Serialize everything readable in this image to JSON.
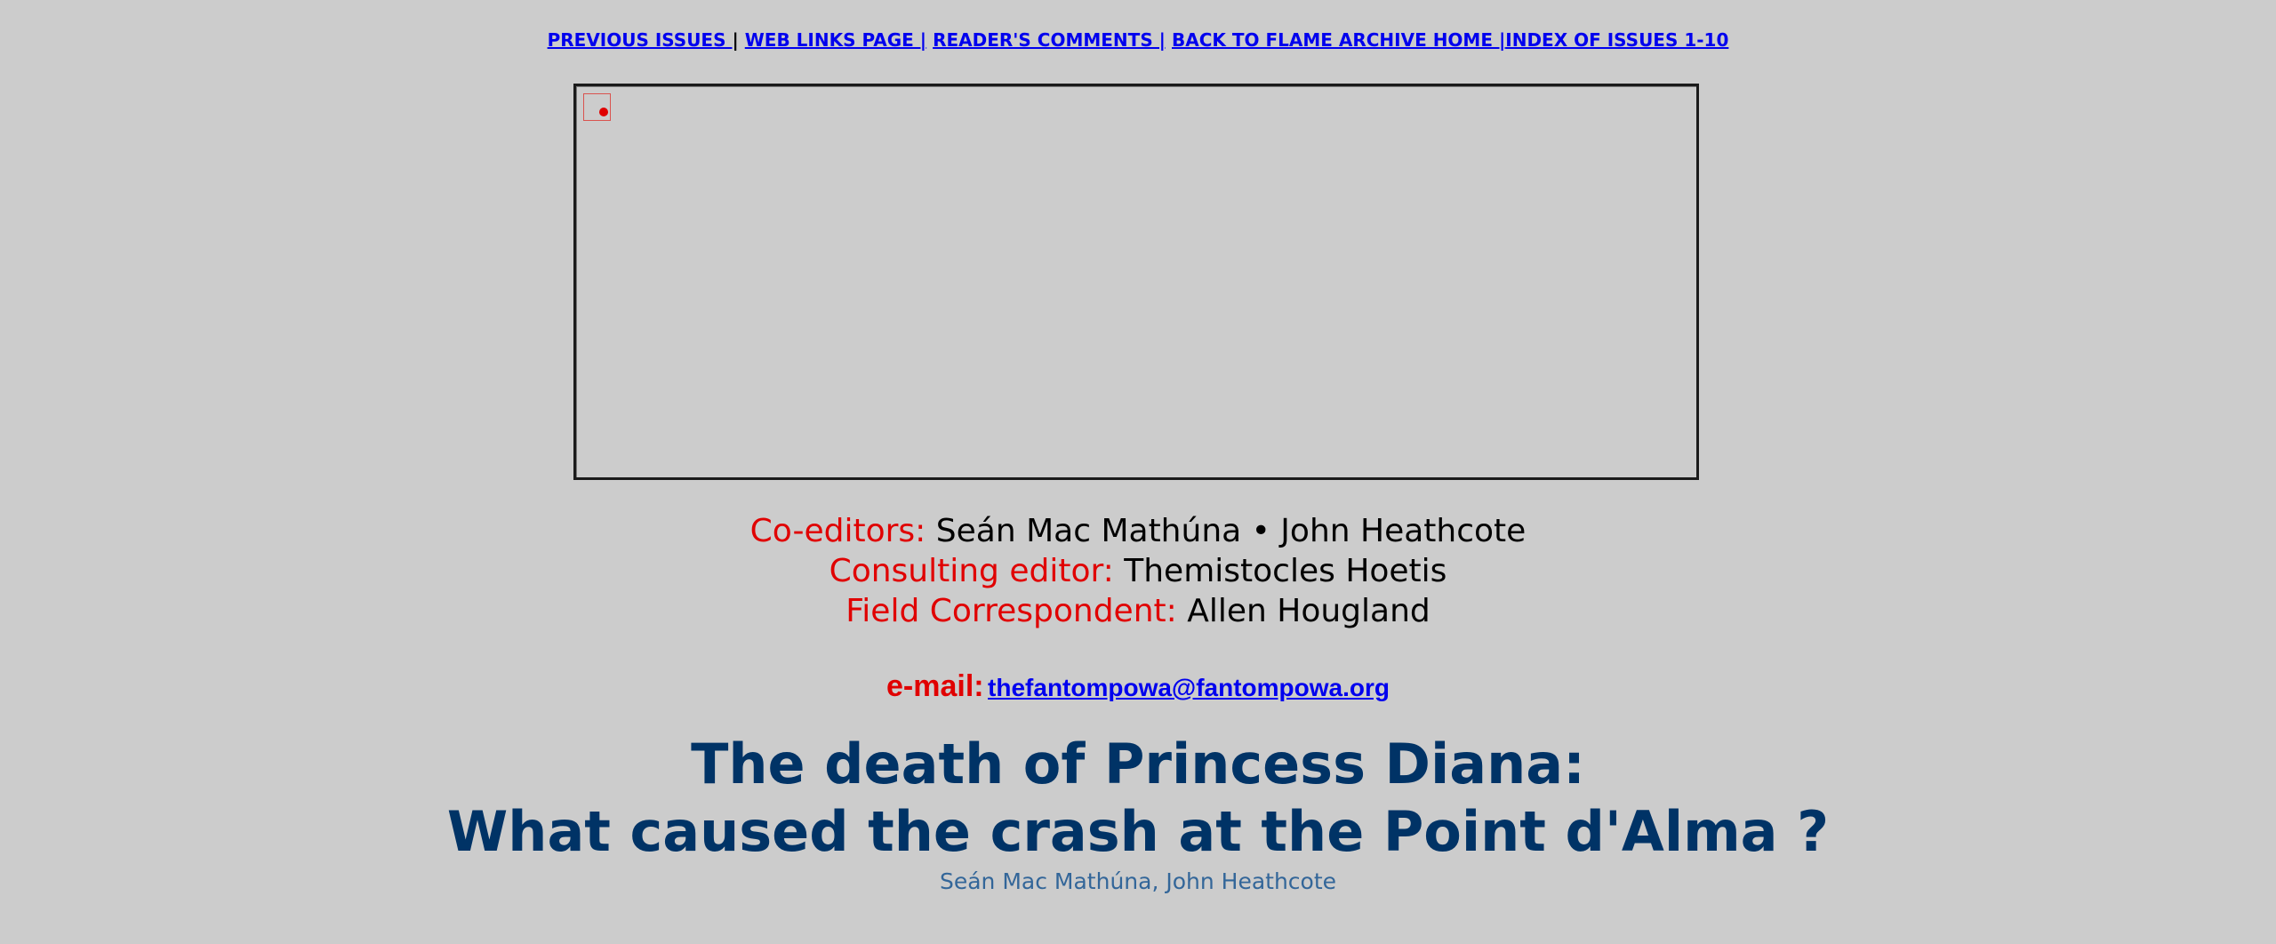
{
  "nav": {
    "previous_issues": "PREVIOUS ISSUES ",
    "sep1": " | ",
    "web_links": "WEB LINKS PAGE |",
    "sep2": " ",
    "readers_comments": "READER'S COMMENTS |",
    "sep3": " ",
    "back_home": "BACK TO FLAME ARCHIVE HOME |",
    "index": "INDEX OF ISSUES 1-10"
  },
  "banner": {
    "broken_image_icon": "broken-image-icon"
  },
  "credits": {
    "coeditors_label": "Co-editors:",
    "coeditors_names": "Seán Mac Mathúna • John Heathcote",
    "consulting_label": "Consulting editor:",
    "consulting_name": "Themistocles Hoetis",
    "field_label": "Field Correspondent:",
    "field_name": "Allen Hougland",
    "email_label": "e-mail:",
    "email_address": "thefantompowa@fantompowa.org"
  },
  "article": {
    "headline_line1": "The death of Princess Diana:",
    "headline_line2": "What caused the crash at the Point d'Alma ?",
    "byline": "Seán Mac Mathúna, John Heathcote"
  },
  "colors": {
    "background": "#cccccc",
    "link": "#0000ee",
    "label_red": "#e00000",
    "headline_navy": "#003366",
    "byline_blue": "#336699"
  }
}
